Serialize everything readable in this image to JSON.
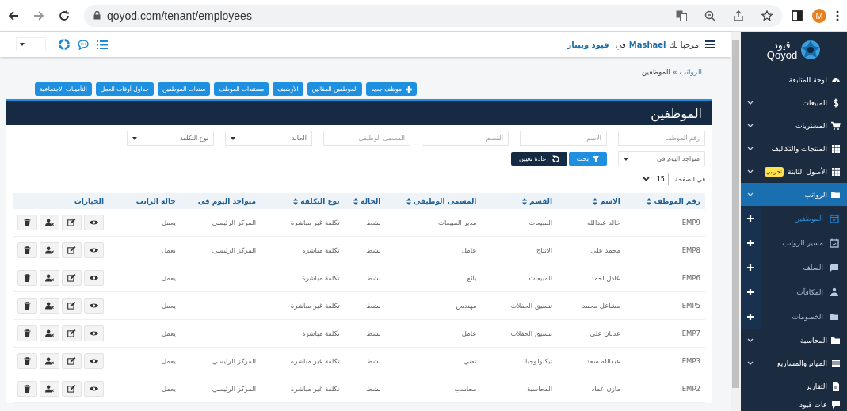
{
  "browser": {
    "url": "qoyod.com/tenant/employees",
    "avatar": "M"
  },
  "topbar": {
    "greeting": "مرحبا بك",
    "user": "Mashael",
    "in": "في",
    "company": "قيود ويبنار"
  },
  "breadcrumb": {
    "parent": "الرواتب",
    "separator": "»",
    "current": "الموظفين"
  },
  "action_buttons": [
    {
      "label": "موظف جديد",
      "kind": "add"
    },
    {
      "label": "الموظفين المقالين",
      "kind": "plain"
    },
    {
      "label": "الأرشيف",
      "kind": "plain"
    },
    {
      "label": "مستندات الموظف",
      "kind": "plain"
    },
    {
      "label": "سندات الموظفين",
      "kind": "plain"
    },
    {
      "label": "جداول أوقات العمل",
      "kind": "plain"
    },
    {
      "label": "التأمينات الاجتماعية",
      "kind": "plain"
    }
  ],
  "panel_title": "الموظفين",
  "filters": [
    {
      "kind": "input",
      "placeholder": "رقم الموظف"
    },
    {
      "kind": "input",
      "placeholder": "الاسم"
    },
    {
      "kind": "input",
      "placeholder": "القسم"
    },
    {
      "kind": "input",
      "placeholder": "المسمى الوظيفي"
    },
    {
      "kind": "select",
      "placeholder": "الحالة"
    },
    {
      "kind": "select",
      "placeholder": "نوع التكلفة"
    },
    {
      "kind": "select",
      "placeholder": "متواجد اليوم في"
    }
  ],
  "search_button": "بحث",
  "reset_button": "إعادة تعيين",
  "page_size": {
    "label": "في الصفحة",
    "value": "15"
  },
  "table": {
    "columns": [
      {
        "label": "رقم الموظف",
        "sortable": true
      },
      {
        "label": "الاسم",
        "sortable": true
      },
      {
        "label": "القسم",
        "sortable": true
      },
      {
        "label": "المسمى الوظيفي",
        "sortable": true
      },
      {
        "label": "الحالة",
        "sortable": true
      },
      {
        "label": "نوع التكلفة",
        "sortable": true
      },
      {
        "label": "متواجد اليوم في",
        "sortable": false
      },
      {
        "label": "حالة الراتب",
        "sortable": false
      },
      {
        "label": "الخيارات",
        "sortable": false
      }
    ],
    "rows": [
      [
        "EMP9",
        "خالد عبدالله",
        "المبيعات",
        "مدير المبيعات",
        "نشط",
        "تكلفة غير مباشرة",
        "المركز الرئيسي",
        "يعمل"
      ],
      [
        "EMP8",
        "محمد علي",
        "الانتاج",
        "عامل",
        "نشط",
        "تكلفة مباشرة",
        "المركز الرئيسي",
        "يعمل"
      ],
      [
        "EMP6",
        "عادل احمد",
        "المبيعات",
        "بائع",
        "نشط",
        "تكلفة مباشرة",
        "",
        "يعمل"
      ],
      [
        "EMP5",
        "مشاعل محمد",
        "تنسيق الحفلات",
        "مهندس",
        "نشط",
        "تكلفة غير مباشرة",
        "",
        "يعمل"
      ],
      [
        "EMP7",
        "عدنان علي",
        "تنسيق الحفلات",
        "عامل",
        "نشط",
        "تكلفة مباشرة",
        "",
        "يعمل"
      ],
      [
        "EMP3",
        "عبدالله سعد",
        "تيكنولوجيا",
        "تقني",
        "نشط",
        "تكلفة غير مباشرة",
        "المركز الرئيسي",
        "يعمل"
      ],
      [
        "EMP2",
        "مازن عماد",
        "المحاسبة",
        "محاسب",
        "نشط",
        "تكلفة غير مباشرة",
        "المركز الرئيسي",
        "يعمل"
      ]
    ]
  },
  "sidebar": {
    "logo_arabic": "قيود",
    "logo_latin": "Qoyod",
    "items": [
      {
        "label": "لوحة المتابعة",
        "has_submenu": false,
        "selected": false
      },
      {
        "label": "المبيعات",
        "has_submenu": true,
        "selected": false
      },
      {
        "label": "المشتريات",
        "has_submenu": true,
        "selected": false
      },
      {
        "label": "المنتجات والتكاليف",
        "has_submenu": true,
        "selected": false
      },
      {
        "label": "الأصول الثابتة",
        "has_submenu": true,
        "selected": false,
        "badge": "تجريبي"
      },
      {
        "label": "الرواتب",
        "has_submenu": true,
        "selected": true,
        "children": [
          {
            "label": "الموظفين",
            "selected": true
          },
          {
            "label": "مسير الرواتب",
            "selected": false
          },
          {
            "label": "السلف",
            "selected": false
          },
          {
            "label": "المكافآت",
            "selected": false
          },
          {
            "label": "الخصومات",
            "selected": false
          }
        ]
      },
      {
        "label": "المحاسبة",
        "has_submenu": true,
        "selected": false
      },
      {
        "label": "المهام والمشاريع",
        "has_submenu": true,
        "selected": false
      },
      {
        "label": "التقارير",
        "has_submenu": false,
        "selected": false
      },
      {
        "label": "عات قيود",
        "has_submenu": false,
        "selected": false
      }
    ]
  }
}
